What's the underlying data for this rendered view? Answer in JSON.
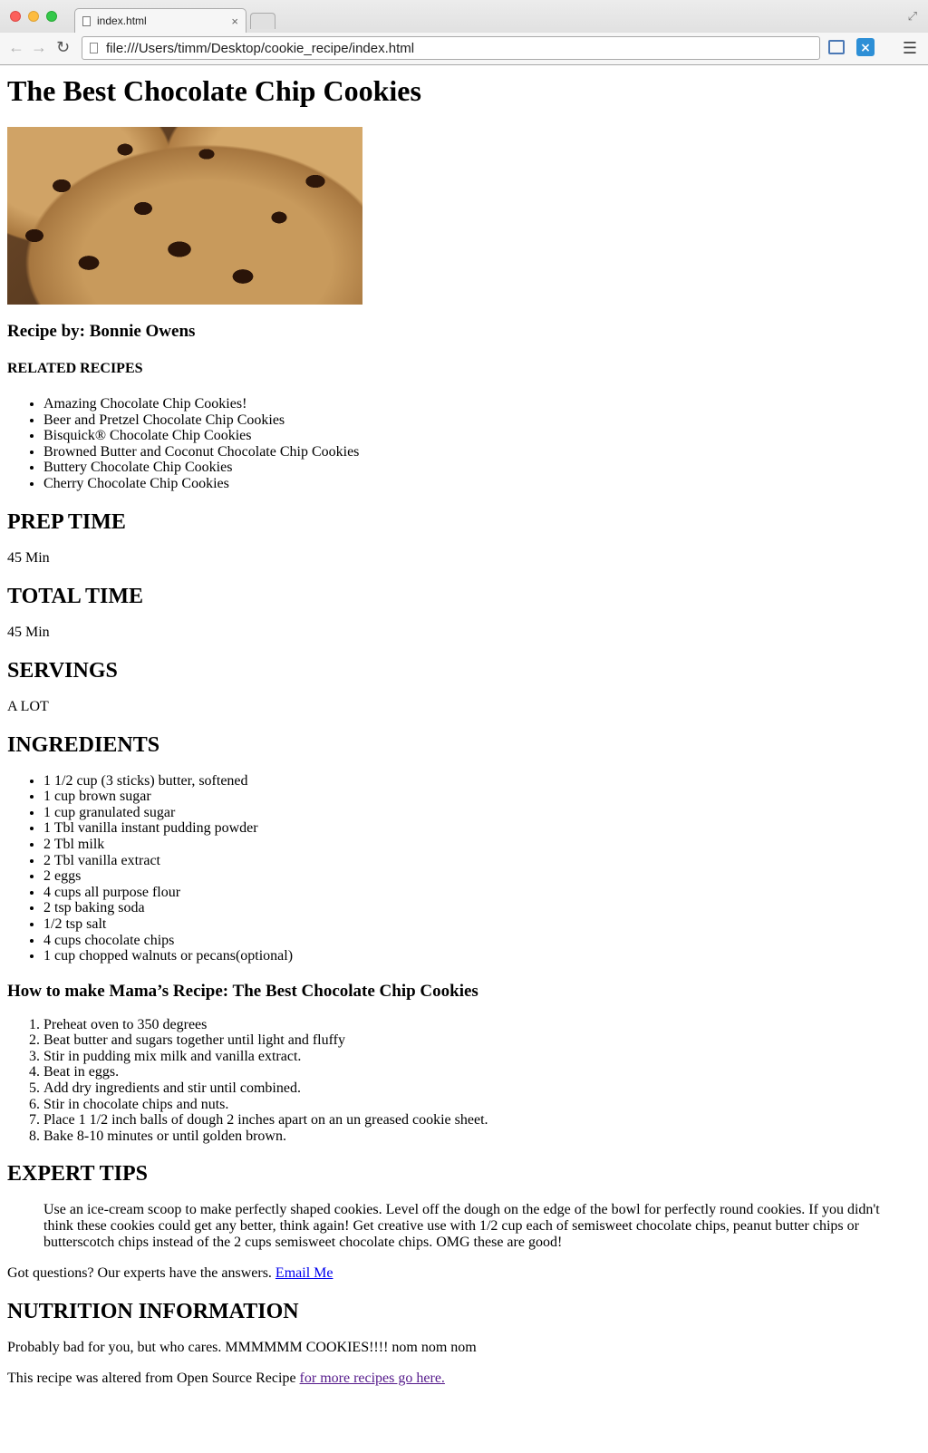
{
  "browser": {
    "tab_title": "index.html",
    "tab_close": "×",
    "url": "file:///Users/timm/Desktop/cookie_recipe/index.html"
  },
  "page": {
    "title": "The Best Chocolate Chip Cookies",
    "image_alt": "chocolate chip cookies photo",
    "recipe_by": "Recipe by: Bonnie Owens",
    "related_heading": "RELATED RECIPES",
    "related_recipes": [
      "Amazing Chocolate Chip Cookies!",
      "Beer and Pretzel Chocolate Chip Cookies",
      "Bisquick® Chocolate Chip Cookies",
      "Browned Butter and Coconut Chocolate Chip Cookies",
      "Buttery Chocolate Chip Cookies",
      "Cherry Chocolate Chip Cookies"
    ],
    "prep_time_heading": "PREP TIME",
    "prep_time": "45 Min",
    "total_time_heading": "TOTAL TIME",
    "total_time": "45 Min",
    "servings_heading": "SERVINGS",
    "servings": "A LOT",
    "ingredients_heading": "INGREDIENTS",
    "ingredients": [
      "1 1/2 cup (3 sticks) butter, softened",
      "1 cup brown sugar",
      "1 cup granulated sugar",
      "1 Tbl vanilla instant pudding powder",
      "2 Tbl milk",
      "2 Tbl vanilla extract",
      "2 eggs",
      "4 cups all purpose flour",
      "2 tsp baking soda",
      "1/2 tsp salt",
      "4 cups chocolate chips",
      "1 cup chopped walnuts or pecans(optional)"
    ],
    "howto_heading": "How to make Mama’s Recipe: The Best Chocolate Chip Cookies",
    "steps": [
      "Preheat oven to 350 degrees",
      "Beat butter and sugars together until light and fluffy",
      "Stir in pudding mix milk and vanilla extract.",
      "Beat in eggs.",
      "Add dry ingredients and stir until combined.",
      "Stir in chocolate chips and nuts.",
      "Place 1 1/2 inch balls of dough 2 inches apart on an un greased cookie sheet.",
      "Bake 8-10 minutes or until golden brown."
    ],
    "tips_heading": "EXPERT TIPS",
    "tips_text": "Use an ice-cream scoop to make perfectly shaped cookies. Level off the dough on the edge of the bowl for perfectly round cookies. If you didn't think these cookies could get any better, think again! Get creative use with 1/2 cup each of semisweet chocolate chips, peanut butter chips or butterscotch chips instead of the 2 cups semisweet chocolate chips. OMG these are good!",
    "questions_text": "Got questions? Our experts have the answers. ",
    "email_link": "Email Me",
    "nutrition_heading": "NUTRITION INFORMATION",
    "nutrition_text": "Probably bad for you, but who cares. MMMMMM COOKIES!!!! nom nom nom",
    "source_text": "This recipe was altered from Open Source Recipe ",
    "source_link": "for more recipes go here."
  }
}
